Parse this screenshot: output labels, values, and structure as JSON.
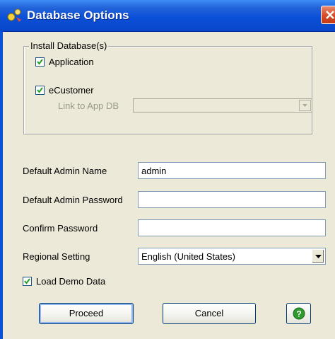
{
  "window": {
    "title": "Database Options"
  },
  "install_group": {
    "label": "Install Database(s)",
    "application": {
      "label": "Application",
      "checked": true
    },
    "ecustomer": {
      "label": "eCustomer",
      "checked": true
    },
    "link_to_app_db": {
      "label": "Link to App DB",
      "value": "",
      "enabled": false
    }
  },
  "form": {
    "admin_name": {
      "label": "Default Admin Name",
      "value": "admin"
    },
    "admin_password": {
      "label": "Default Admin Password",
      "value": ""
    },
    "confirm_password": {
      "label": "Confirm Password",
      "value": ""
    },
    "regional_setting": {
      "label": "Regional Setting",
      "value": "English (United States)"
    },
    "load_demo_data": {
      "label": "Load Demo Data",
      "checked": true
    }
  },
  "buttons": {
    "proceed": "Proceed",
    "cancel": "Cancel"
  },
  "colors": {
    "title_bar": "#0b50d8",
    "dialog_bg": "#ece9d8",
    "close_button": "#d54a24",
    "help_green": "#2e9a2e"
  }
}
